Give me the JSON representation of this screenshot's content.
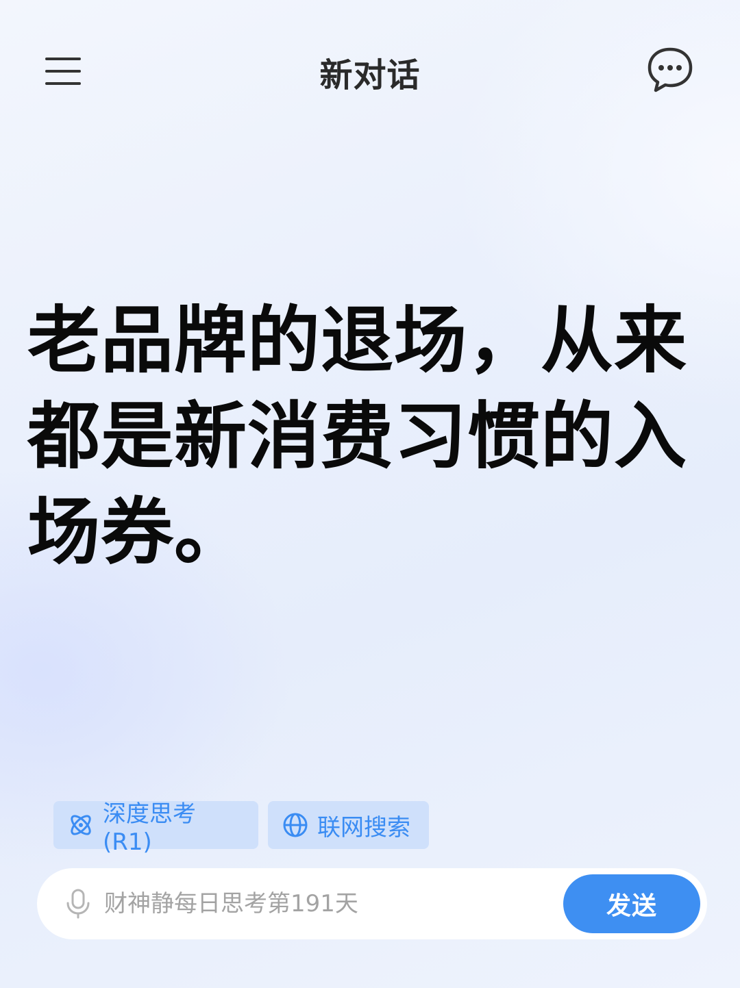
{
  "header": {
    "title": "新对话",
    "menu_icon": "hamburger-menu-icon",
    "chat_icon": "chat-bubble-icon"
  },
  "headline": {
    "text": "老品牌的退场，从来都是新消费习惯的入场券。"
  },
  "chips": [
    {
      "label": "深度思考(R1)",
      "icon": "atom-icon"
    },
    {
      "label": "联网搜索",
      "icon": "globe-icon"
    }
  ],
  "input": {
    "placeholder": "财神静每日思考第191天",
    "value": "",
    "mic_icon": "microphone-icon"
  },
  "send": {
    "label": "发送"
  },
  "colors": {
    "accent": "#3e8ff2",
    "chip_bg": "#cfe0fb",
    "chip_text": "#3a8cf3"
  }
}
